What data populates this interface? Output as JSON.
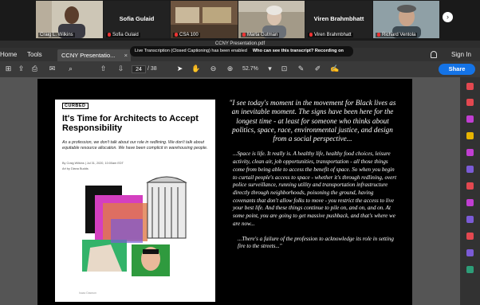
{
  "zoom_participants": [
    {
      "name": "Craig L. Wilkins",
      "display": ""
    },
    {
      "name": "Sofia Gulaid",
      "display": "Sofia Gulaid"
    },
    {
      "name": "CSA 100",
      "display": ""
    },
    {
      "name": "Marta Gutman",
      "display": ""
    },
    {
      "name": "Viren Brahmbhatt",
      "display": "Viren Brahmbhatt"
    },
    {
      "name": "Richard Ventola",
      "display": ""
    }
  ],
  "window_title": "CCNY Presentation.pdf",
  "menu": {
    "home": "Home",
    "tools": "Tools",
    "tab_label": "CCNY Presentatio...",
    "tab_close": "×",
    "sign_in": "Sign In"
  },
  "caption_banner": {
    "text": "Live Transcription (Closed Captioning) has been enabled",
    "link": "Who can see this transcript? Recording on"
  },
  "toolbar": {
    "page_current": "24",
    "page_total": "/ 38",
    "zoom": "52.7%",
    "share": "Share"
  },
  "article": {
    "publication": "CURBED",
    "title": "It's Time for Architects to Accept Responsibility",
    "dek": "As a profession, we don't talk about our role in redlining. We don't talk about equitable resource allocation. We have been complicit in warehousing people.",
    "byline": "By Craig Wilkins | Jul 31, 2020, 10:00am EDT",
    "credit": "Art by Diana Budds",
    "image_caption": "Isaac Dawson"
  },
  "quote": {
    "p1": "\"I see today's moment in the movement for Black lives as an inevitable moment. The signs have been here for the longest time - at least for someone who thinks about politics, space, race, environmental justice, and design from a social perspective...",
    "p2": "...Space is life. It really is. A healthy life, healthy food choices, leisure activity, clean air, job opportunities, transportation - all those things come from being able to access the benefit of space. So when you begin to curtail people's access to space - whether it's through redlining, overt police surveillance, running utility and transportation infrastructure directly through neighborhoods, poisoning the ground, having covenants that don't allow folks to move - you restrict the access to live your best life. And these things continue to pile on, and on, and on. At some point, you are going to get massive pushback, and that's where we are now...",
    "p3": "...There's a failure of the profession to acknowledge its role in setting fire to the streets...\""
  },
  "colors": {
    "accent": "#1473e6",
    "page_bg": "#000000"
  }
}
